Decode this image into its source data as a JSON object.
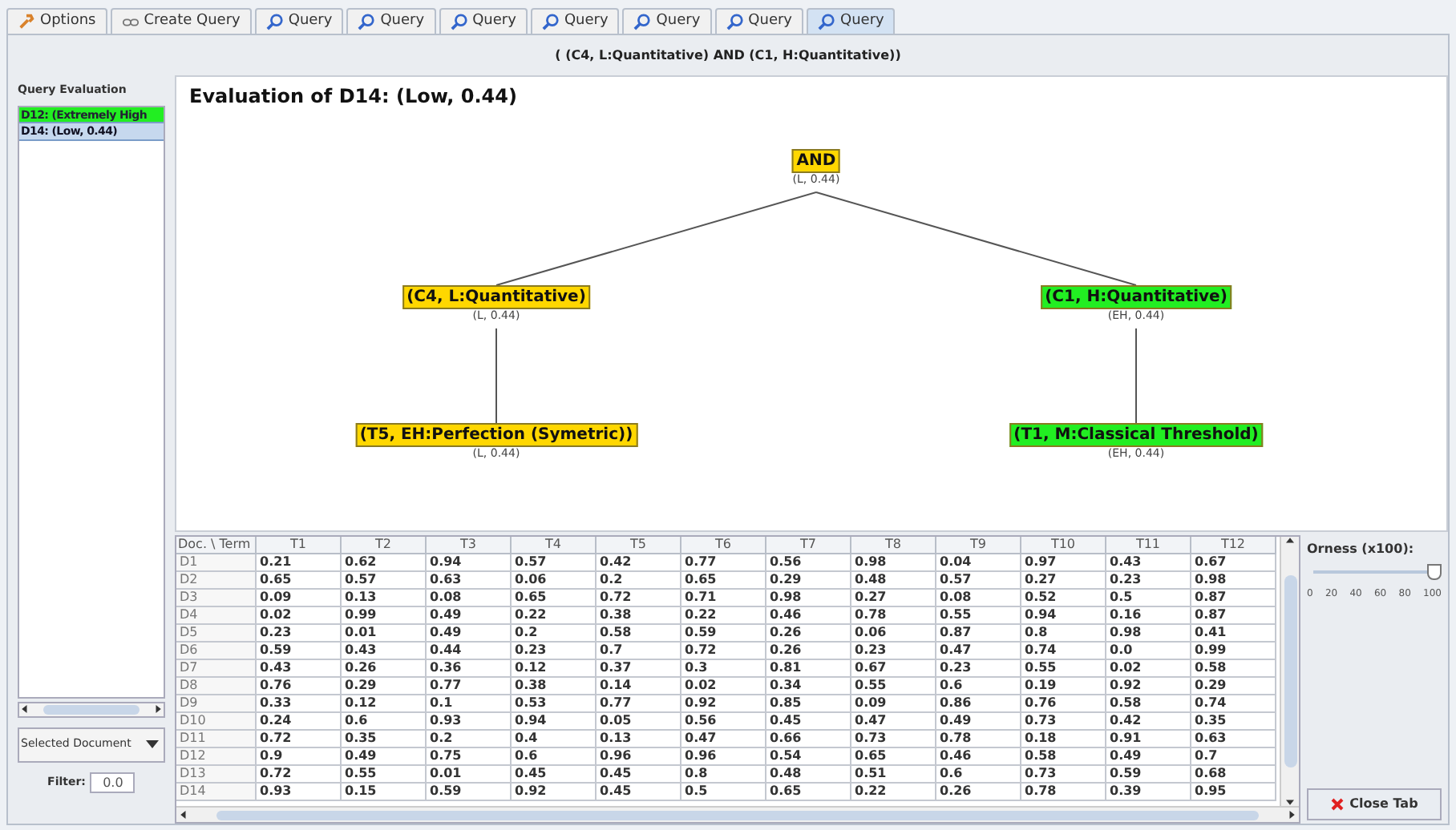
{
  "tabs": [
    {
      "label": "Options",
      "kind": "options",
      "selected": false
    },
    {
      "label": "Create Query",
      "kind": "create",
      "selected": false
    },
    {
      "label": "Query",
      "kind": "query",
      "selected": false
    },
    {
      "label": "Query",
      "kind": "query",
      "selected": false
    },
    {
      "label": "Query",
      "kind": "query",
      "selected": false
    },
    {
      "label": "Query",
      "kind": "query",
      "selected": false
    },
    {
      "label": "Query",
      "kind": "query",
      "selected": false
    },
    {
      "label": "Query",
      "kind": "query",
      "selected": false
    },
    {
      "label": "Query",
      "kind": "query",
      "selected": true
    }
  ],
  "query_expression": "( (C4, L:Quantitative) AND (C1, H:Quantitative))",
  "sidebar": {
    "title": "Query Evaluation",
    "items": [
      {
        "label": "D12: (Extremely High",
        "color": "#22ee22",
        "selected": false
      },
      {
        "label": "D14: (Low, 0.44)",
        "color": "#c6d8ee",
        "selected": true
      }
    ],
    "dropdown": {
      "value": "Selected Document"
    },
    "filter": {
      "label": "Filter:",
      "value": "0.0"
    }
  },
  "evaluation": {
    "title": "Evaluation of D14: (Low, 0.44)",
    "tree": {
      "label": "AND",
      "value": "(L, 0.44)",
      "color": "#ffd700",
      "children": [
        {
          "label": "(C4, L:Quantitative)",
          "value": "(L, 0.44)",
          "color": "#ffd700",
          "children": [
            {
              "label": "(T5, EH:Perfection (Symetric))",
              "value": "(L, 0.44)",
              "color": "#ffd700"
            }
          ]
        },
        {
          "label": "(C1, H:Quantitative)",
          "value": "(EH, 0.44)",
          "color": "#22ee22",
          "children": [
            {
              "label": "(T1, M:Classical Threshold)",
              "value": "(EH, 0.44)",
              "color": "#22ee22"
            }
          ]
        }
      ]
    }
  },
  "table": {
    "columns": [
      "Doc. \\ Term",
      "T1",
      "T2",
      "T3",
      "T4",
      "T5",
      "T6",
      "T7",
      "T8",
      "T9",
      "T10",
      "T11",
      "T12"
    ],
    "rows": [
      [
        "D1",
        "0.21",
        "0.62",
        "0.94",
        "0.57",
        "0.42",
        "0.77",
        "0.56",
        "0.98",
        "0.04",
        "0.97",
        "0.43",
        "0.67"
      ],
      [
        "D2",
        "0.65",
        "0.57",
        "0.63",
        "0.06",
        "0.2",
        "0.65",
        "0.29",
        "0.48",
        "0.57",
        "0.27",
        "0.23",
        "0.98"
      ],
      [
        "D3",
        "0.09",
        "0.13",
        "0.08",
        "0.65",
        "0.72",
        "0.71",
        "0.98",
        "0.27",
        "0.08",
        "0.52",
        "0.5",
        "0.87"
      ],
      [
        "D4",
        "0.02",
        "0.99",
        "0.49",
        "0.22",
        "0.38",
        "0.22",
        "0.46",
        "0.78",
        "0.55",
        "0.94",
        "0.16",
        "0.87"
      ],
      [
        "D5",
        "0.23",
        "0.01",
        "0.49",
        "0.2",
        "0.58",
        "0.59",
        "0.26",
        "0.06",
        "0.87",
        "0.8",
        "0.98",
        "0.41"
      ],
      [
        "D6",
        "0.59",
        "0.43",
        "0.44",
        "0.23",
        "0.7",
        "0.72",
        "0.26",
        "0.23",
        "0.47",
        "0.74",
        "0.0",
        "0.99"
      ],
      [
        "D7",
        "0.43",
        "0.26",
        "0.36",
        "0.12",
        "0.37",
        "0.3",
        "0.81",
        "0.67",
        "0.23",
        "0.55",
        "0.02",
        "0.58"
      ],
      [
        "D8",
        "0.76",
        "0.29",
        "0.77",
        "0.38",
        "0.14",
        "0.02",
        "0.34",
        "0.55",
        "0.6",
        "0.19",
        "0.92",
        "0.29"
      ],
      [
        "D9",
        "0.33",
        "0.12",
        "0.1",
        "0.53",
        "0.77",
        "0.92",
        "0.85",
        "0.09",
        "0.86",
        "0.76",
        "0.58",
        "0.74"
      ],
      [
        "D10",
        "0.24",
        "0.6",
        "0.93",
        "0.94",
        "0.05",
        "0.56",
        "0.45",
        "0.47",
        "0.49",
        "0.73",
        "0.42",
        "0.35"
      ],
      [
        "D11",
        "0.72",
        "0.35",
        "0.2",
        "0.4",
        "0.13",
        "0.47",
        "0.66",
        "0.73",
        "0.78",
        "0.18",
        "0.91",
        "0.63"
      ],
      [
        "D12",
        "0.9",
        "0.49",
        "0.75",
        "0.6",
        "0.96",
        "0.96",
        "0.54",
        "0.65",
        "0.46",
        "0.58",
        "0.49",
        "0.7"
      ],
      [
        "D13",
        "0.72",
        "0.55",
        "0.01",
        "0.45",
        "0.45",
        "0.8",
        "0.48",
        "0.51",
        "0.6",
        "0.73",
        "0.59",
        "0.68"
      ],
      [
        "D14",
        "0.93",
        "0.15",
        "0.59",
        "0.92",
        "0.45",
        "0.5",
        "0.65",
        "0.22",
        "0.26",
        "0.78",
        "0.39",
        "0.95"
      ]
    ]
  },
  "orness": {
    "label": "Orness (x100):",
    "level": 1.0,
    "ticks": [
      "0",
      "20",
      "40",
      "60",
      "80",
      "100"
    ]
  },
  "close_button": {
    "label": "Close Tab"
  }
}
